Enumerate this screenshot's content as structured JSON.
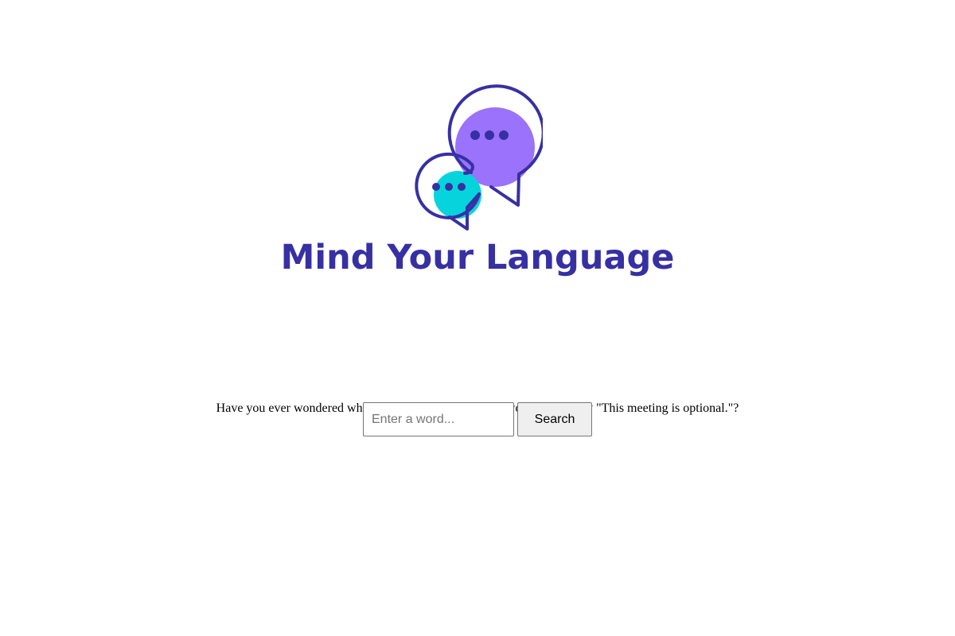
{
  "brand": {
    "title": "Mind Your Language",
    "logo_icon": "chat-bubbles-icon",
    "colors": {
      "primary": "#3730a3",
      "bubble_large": "#9b72fb",
      "bubble_small": "#06d4dd"
    }
  },
  "tagline": "Have you ever wondered what you're really saying when you casually say \"This meeting is optional.\"?",
  "search": {
    "placeholder": "Enter a word...",
    "value": "",
    "button_label": "Search"
  }
}
